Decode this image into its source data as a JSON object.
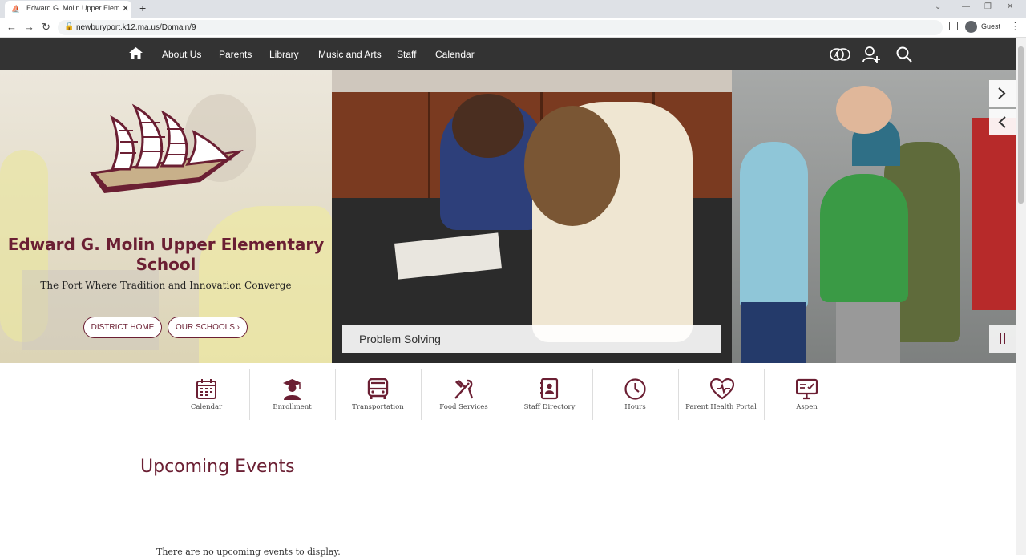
{
  "browser": {
    "tab_title": "Edward G. Molin Upper Elementa",
    "tab_close": "✕",
    "new_tab": "+",
    "url": "newburyport.k12.ma.us/Domain/9",
    "profile_label": "Guest"
  },
  "nav": {
    "items": [
      "About Us",
      "Parents",
      "Library",
      "Music and Arts",
      "Staff",
      "Calendar"
    ]
  },
  "hero": {
    "school_name": "Edward G. Molin Upper Elementary School",
    "tagline": "The Port Where Tradition and Innovation Converge",
    "buttons": [
      "DISTRICT HOME",
      "OUR SCHOOLS ›"
    ],
    "caption": "Problem Solving"
  },
  "quick_links": [
    {
      "label": "Calendar",
      "icon": "calendar-icon"
    },
    {
      "label": "Enrollment",
      "icon": "graduate-icon"
    },
    {
      "label": "Transportation",
      "icon": "bus-icon"
    },
    {
      "label": "Food Services",
      "icon": "utensils-icon"
    },
    {
      "label": "Staff Directory",
      "icon": "directory-icon"
    },
    {
      "label": "Hours",
      "icon": "clock-icon"
    },
    {
      "label": "Parent Health Portal",
      "icon": "heart-icon"
    },
    {
      "label": "Aspen",
      "icon": "monitor-icon"
    }
  ],
  "events": {
    "title": "Upcoming Events",
    "empty_message": "There are no upcoming events to display."
  },
  "colors": {
    "brand": "#6b1f33",
    "nav_bg": "#333333",
    "gold": "#c8b08a"
  }
}
